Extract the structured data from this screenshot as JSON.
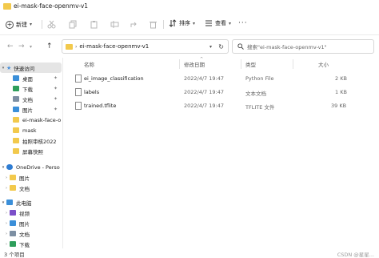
{
  "window": {
    "title": "ei-mask-face-openmv-v1"
  },
  "toolbar": {
    "new_label": "新建",
    "sort_label": "排序",
    "view_label": "查看",
    "more_label": "···"
  },
  "address": {
    "path": "ei-mask-face-openmv-v1",
    "search_placeholder": "搜索\"ei-mask-face-openmv-v1\""
  },
  "sidebar": {
    "items": [
      {
        "label": "快速访问",
        "icon": "star-icon",
        "color": "#4a90d9"
      },
      {
        "label": "桌面",
        "icon": "desktop-icon",
        "color": "#3b8fd9",
        "pinned": "📌"
      },
      {
        "label": "下载",
        "icon": "download-icon",
        "color": "#2e9e5b",
        "pinned": "📌"
      },
      {
        "label": "文档",
        "icon": "document-icon",
        "color": "#7d8fa3",
        "pinned": "📌"
      },
      {
        "label": "图片",
        "icon": "picture-icon",
        "color": "#3b8fd9",
        "pinned": "📌"
      },
      {
        "label": "ei-mask-face-o",
        "icon": "folder-icon",
        "color": "#f2c94c"
      },
      {
        "label": "mask",
        "icon": "folder-icon",
        "color": "#f2c94c"
      },
      {
        "label": "拍照审核2022",
        "icon": "folder-icon",
        "color": "#f2c94c"
      },
      {
        "label": "屏幕快照",
        "icon": "folder-icon",
        "color": "#f2c94c"
      },
      {
        "label": "OneDrive - Perso",
        "icon": "cloud-icon",
        "color": "#2f7dd3"
      },
      {
        "label": "图片",
        "icon": "folder-icon",
        "color": "#f2c94c"
      },
      {
        "label": "文档",
        "icon": "folder-icon",
        "color": "#f2c94c"
      },
      {
        "label": "此电脑",
        "icon": "computer-icon",
        "color": "#3b8fd9"
      },
      {
        "label": "视频",
        "icon": "video-icon",
        "color": "#7b4fc9"
      },
      {
        "label": "图片",
        "icon": "picture-icon",
        "color": "#3b8fd9"
      },
      {
        "label": "文档",
        "icon": "document-icon",
        "color": "#7d8fa3"
      },
      {
        "label": "下载",
        "icon": "download-icon",
        "color": "#2e9e5b"
      }
    ]
  },
  "columns": {
    "name": "名称",
    "modified": "修改日期",
    "type": "类型",
    "size": "大小"
  },
  "files": [
    {
      "name": "ei_image_classification",
      "modified": "2022/4/7 19:47",
      "type": "Python File",
      "size": "2 KB"
    },
    {
      "name": "labels",
      "modified": "2022/4/7 19:47",
      "type": "文本文档",
      "size": "1 KB"
    },
    {
      "name": "trained.tflite",
      "modified": "2022/4/7 19:47",
      "type": "TFLITE 文件",
      "size": "39 KB"
    }
  ],
  "status": {
    "item_count": "3 个项目"
  },
  "watermark": "CSDN @星星..."
}
